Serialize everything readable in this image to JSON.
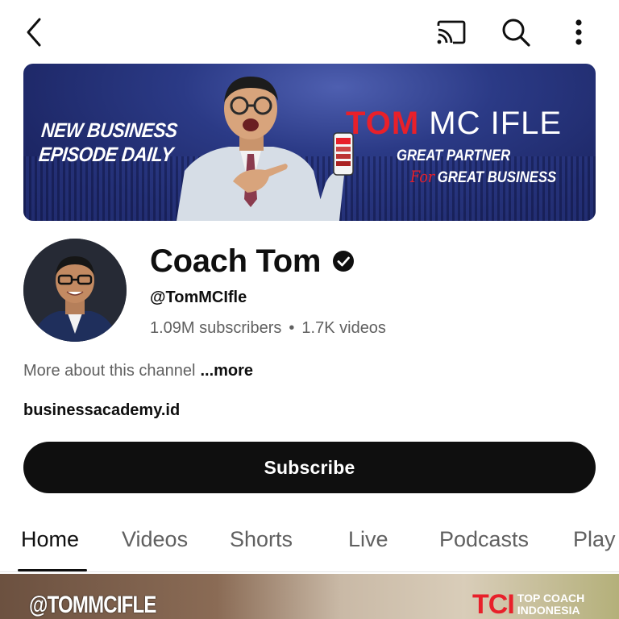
{
  "topbar": {
    "back_icon": "chevron-left-icon",
    "cast_icon": "cast-icon",
    "search_icon": "search-icon",
    "more_icon": "more-vertical-icon"
  },
  "banner": {
    "left_line1": "NEW BUSINESS",
    "left_line2": "EPISODE DAILY",
    "name_red": "TOM",
    "name_white": "MC IFLE",
    "tagline1": "GREAT PARTNER",
    "tagline_for": "For",
    "tagline2": "GREAT BUSINESS",
    "colors": {
      "background": "#24307a",
      "accent": "#e8202a"
    }
  },
  "channel": {
    "name": "Coach Tom",
    "handle": "@TomMCIfle",
    "subscribers": "1.09M subscribers",
    "separator": "•",
    "videos": "1.7K videos",
    "about_text": "More about this channel",
    "about_more": "...more",
    "link": "businessacademy.id",
    "subscribe_label": "Subscribe"
  },
  "tabs": [
    {
      "label": "Home",
      "active": true
    },
    {
      "label": "Videos",
      "active": false
    },
    {
      "label": "Shorts",
      "active": false
    },
    {
      "label": "Live",
      "active": false
    },
    {
      "label": "Podcasts",
      "active": false
    },
    {
      "label": "Play",
      "active": false
    }
  ],
  "thumbnail": {
    "handle_text": "@TOMMCIFLE",
    "brand_logo": "TCI",
    "brand_line1": "TOP COACH",
    "brand_line2": "INDONESIA"
  }
}
